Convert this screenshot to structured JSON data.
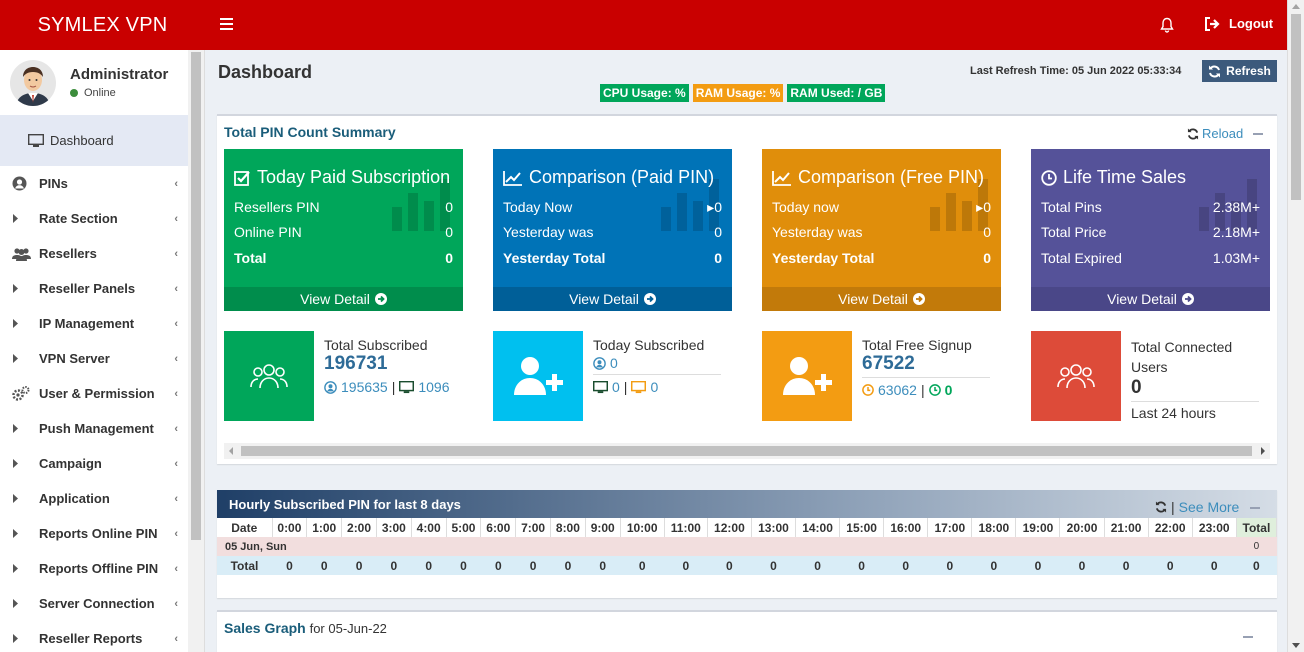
{
  "app": {
    "title": "SYMLEX VPN",
    "logout_label": "Logout"
  },
  "user": {
    "name": "Administrator",
    "status": "Online"
  },
  "sidebar": {
    "dashboard_label": "Dashboard",
    "items": [
      {
        "label": "PINs",
        "icon": "user-circle-icon"
      },
      {
        "label": "Rate Section",
        "icon": "caret-right-icon"
      },
      {
        "label": "Resellers",
        "icon": "users-icon"
      },
      {
        "label": "Reseller Panels",
        "icon": "caret-right-icon"
      },
      {
        "label": "IP Management",
        "icon": "caret-right-icon"
      },
      {
        "label": "VPN Server",
        "icon": "caret-right-icon"
      },
      {
        "label": "User & Permission",
        "icon": "cogs-icon"
      },
      {
        "label": "Push Management",
        "icon": "caret-right-icon"
      },
      {
        "label": "Campaign",
        "icon": "caret-right-icon"
      },
      {
        "label": "Application",
        "icon": "caret-right-icon"
      },
      {
        "label": "Reports Online PIN",
        "icon": "caret-right-icon"
      },
      {
        "label": "Reports Offline PIN",
        "icon": "caret-right-icon"
      },
      {
        "label": "Server Connection",
        "icon": "caret-right-icon"
      },
      {
        "label": "Reseller Reports",
        "icon": "caret-right-icon"
      }
    ]
  },
  "header": {
    "page_title": "Dashboard",
    "last_refresh": "Last Refresh Time: 05 Jun 2022 05:33:34",
    "refresh_label": "Refresh",
    "cpu": "CPU Usage: %",
    "ram": "RAM Usage: %",
    "ram_used": "RAM Used: / GB"
  },
  "summary": {
    "title": "Total PIN Count Summary",
    "reload_label": "Reload",
    "cards": [
      {
        "title": "Today Paid Subscription",
        "color": "#00a65a",
        "foot": "#008d4c",
        "rows": [
          [
            "Resellers PIN",
            "0"
          ],
          [
            "Online PIN",
            "0"
          ],
          [
            "Total",
            "0"
          ]
        ],
        "view": "View Detail"
      },
      {
        "title": "Comparison (Paid PIN)",
        "color": "#0073b7",
        "foot": "#005f98",
        "rows": [
          [
            "Today Now",
            "0"
          ],
          [
            "Yesterday was",
            "0"
          ],
          [
            "Yesterday Total",
            "0"
          ]
        ],
        "view": "View Detail"
      },
      {
        "title": "Comparison (Free PIN)",
        "color": "#e08e0b",
        "foot": "#c27a0a",
        "rows": [
          [
            "Today now",
            "0"
          ],
          [
            "Yesterday was",
            "0"
          ],
          [
            "Yesterday Total",
            "0"
          ]
        ],
        "view": "View Detail"
      },
      {
        "title": "Life Time Sales",
        "color": "#555299",
        "foot": "#4a4788",
        "rows": [
          [
            "Total Pins",
            "2.38M+"
          ],
          [
            "Total Price",
            "2.18M+"
          ],
          [
            "Total Expired",
            "1.03M+"
          ]
        ],
        "view": "View Detail"
      }
    ],
    "info": [
      {
        "label": "Total Subscribed",
        "value": "196731",
        "sub1": "195635",
        "sep": "|",
        "sub2": "1096",
        "color": "#00a65a"
      },
      {
        "label": "Today Subscribed",
        "sub1": "0",
        "sub2": "0",
        "sub3": "0",
        "color": "#00c0ef"
      },
      {
        "label": "Total Free Signup",
        "value": "67522",
        "sub1": "63062",
        "sub2": "0",
        "color": "#f39c12"
      },
      {
        "label": "Total Connected Users",
        "value": "0",
        "foot": "Last 24 hours",
        "color": "#dd4b39"
      }
    ]
  },
  "hourly": {
    "title": "Hourly Subscribed PIN for last 8 days",
    "see_more": "See More",
    "columns": [
      "Date",
      "0:00",
      "1:00",
      "2:00",
      "3:00",
      "4:00",
      "5:00",
      "6:00",
      "7:00",
      "8:00",
      "9:00",
      "10:00",
      "11:00",
      "12:00",
      "13:00",
      "14:00",
      "15:00",
      "16:00",
      "17:00",
      "18:00",
      "19:00",
      "20:00",
      "21:00",
      "22:00",
      "23:00",
      "Total"
    ],
    "day_label": "05 Jun, Sun",
    "day_total": "0",
    "total_label": "Total",
    "totals": [
      "0",
      "0",
      "0",
      "0",
      "0",
      "0",
      "0",
      "0",
      "0",
      "0",
      "0",
      "0",
      "0",
      "0",
      "0",
      "0",
      "0",
      "0",
      "0",
      "0",
      "0",
      "0",
      "0",
      "0",
      "0"
    ]
  },
  "sales": {
    "title": "Sales Graph",
    "date": "for 05-Jun-22"
  }
}
